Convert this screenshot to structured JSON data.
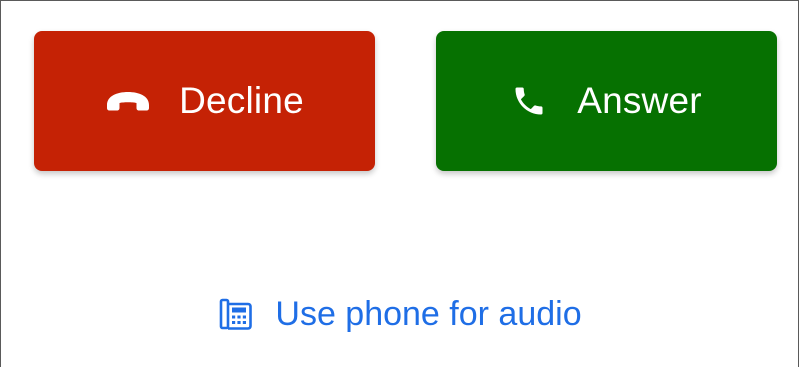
{
  "call_actions": {
    "decline_label": "Decline",
    "answer_label": "Answer",
    "decline_icon": "hang-up-icon",
    "answer_icon": "phone-icon"
  },
  "audio_option": {
    "label": "Use phone for audio",
    "icon": "desk-phone-icon"
  },
  "colors": {
    "decline": "#c52205",
    "answer": "#067101",
    "link": "#1f6ee6"
  }
}
